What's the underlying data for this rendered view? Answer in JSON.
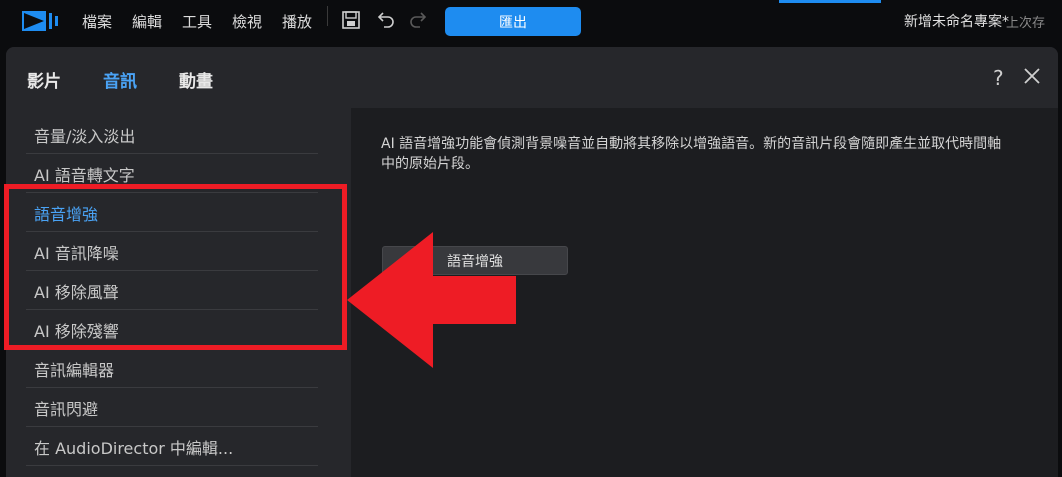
{
  "menubar": {
    "items": [
      "檔案",
      "編輯",
      "工具",
      "檢視",
      "播放"
    ],
    "export_label": "匯出",
    "project_title": "新增未命名專案*",
    "autosave_text": "上次存"
  },
  "toolbar_icons": [
    "save-icon",
    "undo-icon",
    "redo-icon"
  ],
  "dialog": {
    "tabs": [
      {
        "label": "影片",
        "active": false
      },
      {
        "label": "音訊",
        "active": true
      },
      {
        "label": "動畫",
        "active": false
      }
    ],
    "help_label": "?",
    "sidebar": {
      "items": [
        {
          "label": "音量/淡入淡出"
        },
        {
          "label": "AI 語音轉文字"
        },
        {
          "label": "語音增強",
          "selected": true
        },
        {
          "label": "AI 音訊降噪"
        },
        {
          "label": "AI 移除風聲"
        },
        {
          "label": "AI 移除殘響"
        },
        {
          "label": "音訊編輯器"
        },
        {
          "label": "音訊閃避"
        },
        {
          "label": "在 AudioDirector 中編輯..."
        }
      ]
    },
    "content": {
      "description": "AI 語音增強功能會偵測背景噪音並自動將其移除以增強語音。新的音訊片段會隨即產生並取代時間軸中的原始片段。",
      "button_label": "語音增強"
    }
  },
  "colors": {
    "accent": "#1e8cf0",
    "selected_text": "#4aa3f5",
    "annotation": "#ee1c25"
  }
}
